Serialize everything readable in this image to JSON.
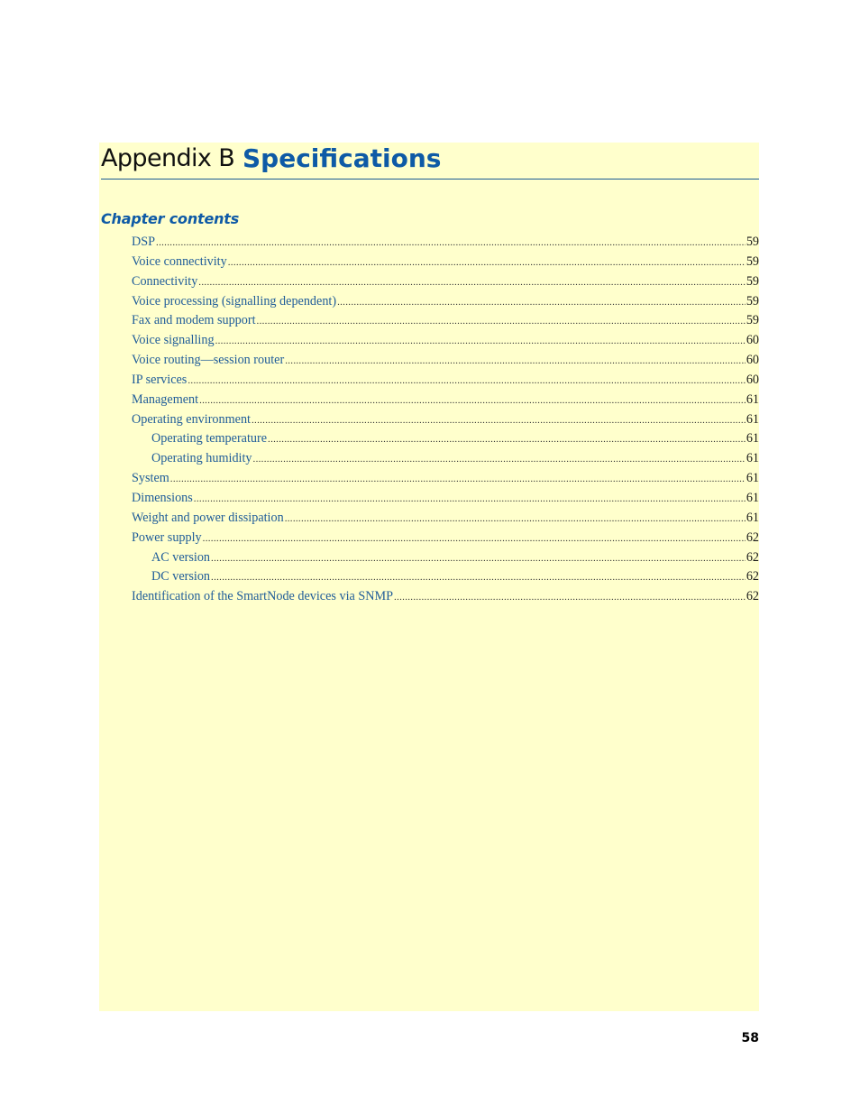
{
  "header": {
    "prefix": "Appendix B",
    "title": "Specifications"
  },
  "section": {
    "heading": "Chapter contents"
  },
  "toc": {
    "entries": [
      {
        "title": "DSP",
        "page": "59",
        "level": 1
      },
      {
        "title": "Voice connectivity",
        "page": "59",
        "level": 1
      },
      {
        "title": "Connectivity",
        "page": "59",
        "level": 1
      },
      {
        "title": "Voice processing (signalling dependent)",
        "page": "59",
        "level": 1
      },
      {
        "title": "Fax and modem support",
        "page": "59",
        "level": 1
      },
      {
        "title": "Voice signalling",
        "page": "60",
        "level": 1
      },
      {
        "title": "Voice routing—session router",
        "page": "60",
        "level": 1
      },
      {
        "title": "IP services",
        "page": "60",
        "level": 1
      },
      {
        "title": "Management",
        "page": "61",
        "level": 1
      },
      {
        "title": "Operating environment",
        "page": "61",
        "level": 1
      },
      {
        "title": "Operating temperature",
        "page": "61",
        "level": 2
      },
      {
        "title": "Operating humidity",
        "page": "61",
        "level": 2
      },
      {
        "title": "System",
        "page": "61",
        "level": 1
      },
      {
        "title": "Dimensions",
        "page": "61",
        "level": 1
      },
      {
        "title": "Weight and power dissipation",
        "page": "61",
        "level": 1
      },
      {
        "title": "Power supply",
        "page": "62",
        "level": 1
      },
      {
        "title": "AC version",
        "page": "62",
        "level": 2
      },
      {
        "title": "DC version",
        "page": "62",
        "level": 2
      },
      {
        "title": "Identification of the SmartNode devices via SNMP",
        "page": "62",
        "level": 1
      }
    ]
  },
  "footer": {
    "page_number": "58"
  },
  "colors": {
    "panel_background": "#ffffcc",
    "title_blue": "#0e5aa6",
    "link_blue": "#1f5c99",
    "rule": "#1a5a94"
  }
}
